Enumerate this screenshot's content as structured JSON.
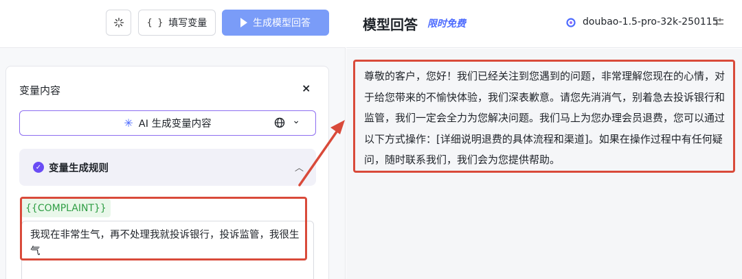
{
  "toolbar": {
    "magic_icon": "sparkle-icon",
    "fill_vars_label": "填写变量",
    "generate_label": "生成模型回答"
  },
  "variable_panel": {
    "title": "变量内容",
    "close_label": "×",
    "ai_button_label": "AI 生成变量内容",
    "rule_label": "变量生成规则",
    "variable_name": "{{COMPLAINT}}",
    "variable_value": "我现在非常生气，再不处理我就投诉银行，投诉监管，我很生气"
  },
  "response_panel": {
    "title": "模型回答",
    "badge": "限时免费",
    "model_name": "doubao-1.5-pro-32k-250115",
    "answer": "尊敬的客户，您好！我们已经关注到您遇到的问题，非常理解您现在的心情，对于给您带来的不愉快体验，我们深表歉意。请您先消消气，别着急去投诉银行和监管，我们一定会全力为您解决问题。我们马上为您办理会员退费，您可以通过以下方式操作：[详细说明退费的具体流程和渠道]。如果在操作过程中有任何疑问，随时联系我们，我们会为您提供帮助。"
  },
  "colors": {
    "primary": "#7a9cf8",
    "accent": "#4d6bfe",
    "annotation": "#d94a3a",
    "variable_tag": "#2f9e44"
  }
}
